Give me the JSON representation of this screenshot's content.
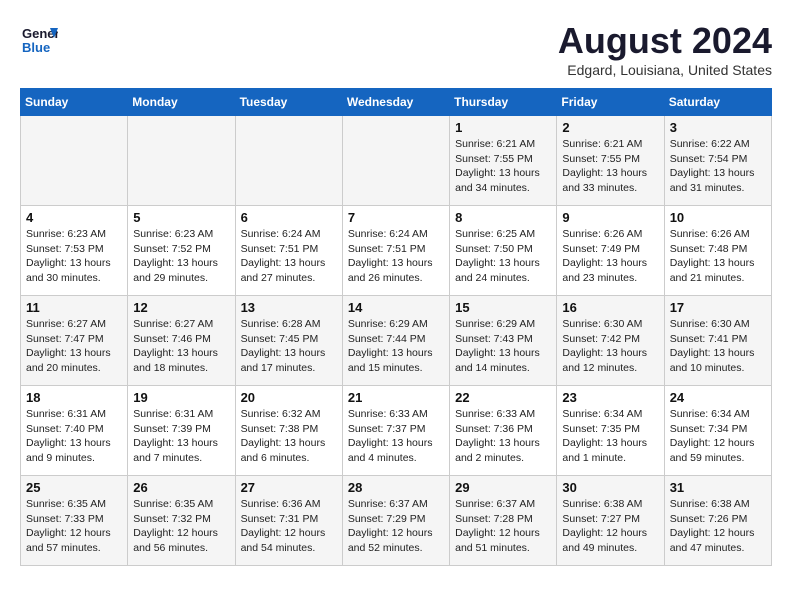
{
  "logo": {
    "line1": "General",
    "line2": "Blue"
  },
  "title": "August 2024",
  "subtitle": "Edgard, Louisiana, United States",
  "days_of_week": [
    "Sunday",
    "Monday",
    "Tuesday",
    "Wednesday",
    "Thursday",
    "Friday",
    "Saturday"
  ],
  "weeks": [
    [
      {
        "day": "",
        "info": ""
      },
      {
        "day": "",
        "info": ""
      },
      {
        "day": "",
        "info": ""
      },
      {
        "day": "",
        "info": ""
      },
      {
        "day": "1",
        "info": "Sunrise: 6:21 AM\nSunset: 7:55 PM\nDaylight: 13 hours\nand 34 minutes."
      },
      {
        "day": "2",
        "info": "Sunrise: 6:21 AM\nSunset: 7:55 PM\nDaylight: 13 hours\nand 33 minutes."
      },
      {
        "day": "3",
        "info": "Sunrise: 6:22 AM\nSunset: 7:54 PM\nDaylight: 13 hours\nand 31 minutes."
      }
    ],
    [
      {
        "day": "4",
        "info": "Sunrise: 6:23 AM\nSunset: 7:53 PM\nDaylight: 13 hours\nand 30 minutes."
      },
      {
        "day": "5",
        "info": "Sunrise: 6:23 AM\nSunset: 7:52 PM\nDaylight: 13 hours\nand 29 minutes."
      },
      {
        "day": "6",
        "info": "Sunrise: 6:24 AM\nSunset: 7:51 PM\nDaylight: 13 hours\nand 27 minutes."
      },
      {
        "day": "7",
        "info": "Sunrise: 6:24 AM\nSunset: 7:51 PM\nDaylight: 13 hours\nand 26 minutes."
      },
      {
        "day": "8",
        "info": "Sunrise: 6:25 AM\nSunset: 7:50 PM\nDaylight: 13 hours\nand 24 minutes."
      },
      {
        "day": "9",
        "info": "Sunrise: 6:26 AM\nSunset: 7:49 PM\nDaylight: 13 hours\nand 23 minutes."
      },
      {
        "day": "10",
        "info": "Sunrise: 6:26 AM\nSunset: 7:48 PM\nDaylight: 13 hours\nand 21 minutes."
      }
    ],
    [
      {
        "day": "11",
        "info": "Sunrise: 6:27 AM\nSunset: 7:47 PM\nDaylight: 13 hours\nand 20 minutes."
      },
      {
        "day": "12",
        "info": "Sunrise: 6:27 AM\nSunset: 7:46 PM\nDaylight: 13 hours\nand 18 minutes."
      },
      {
        "day": "13",
        "info": "Sunrise: 6:28 AM\nSunset: 7:45 PM\nDaylight: 13 hours\nand 17 minutes."
      },
      {
        "day": "14",
        "info": "Sunrise: 6:29 AM\nSunset: 7:44 PM\nDaylight: 13 hours\nand 15 minutes."
      },
      {
        "day": "15",
        "info": "Sunrise: 6:29 AM\nSunset: 7:43 PM\nDaylight: 13 hours\nand 14 minutes."
      },
      {
        "day": "16",
        "info": "Sunrise: 6:30 AM\nSunset: 7:42 PM\nDaylight: 13 hours\nand 12 minutes."
      },
      {
        "day": "17",
        "info": "Sunrise: 6:30 AM\nSunset: 7:41 PM\nDaylight: 13 hours\nand 10 minutes."
      }
    ],
    [
      {
        "day": "18",
        "info": "Sunrise: 6:31 AM\nSunset: 7:40 PM\nDaylight: 13 hours\nand 9 minutes."
      },
      {
        "day": "19",
        "info": "Sunrise: 6:31 AM\nSunset: 7:39 PM\nDaylight: 13 hours\nand 7 minutes."
      },
      {
        "day": "20",
        "info": "Sunrise: 6:32 AM\nSunset: 7:38 PM\nDaylight: 13 hours\nand 6 minutes."
      },
      {
        "day": "21",
        "info": "Sunrise: 6:33 AM\nSunset: 7:37 PM\nDaylight: 13 hours\nand 4 minutes."
      },
      {
        "day": "22",
        "info": "Sunrise: 6:33 AM\nSunset: 7:36 PM\nDaylight: 13 hours\nand 2 minutes."
      },
      {
        "day": "23",
        "info": "Sunrise: 6:34 AM\nSunset: 7:35 PM\nDaylight: 13 hours\nand 1 minute."
      },
      {
        "day": "24",
        "info": "Sunrise: 6:34 AM\nSunset: 7:34 PM\nDaylight: 12 hours\nand 59 minutes."
      }
    ],
    [
      {
        "day": "25",
        "info": "Sunrise: 6:35 AM\nSunset: 7:33 PM\nDaylight: 12 hours\nand 57 minutes."
      },
      {
        "day": "26",
        "info": "Sunrise: 6:35 AM\nSunset: 7:32 PM\nDaylight: 12 hours\nand 56 minutes."
      },
      {
        "day": "27",
        "info": "Sunrise: 6:36 AM\nSunset: 7:31 PM\nDaylight: 12 hours\nand 54 minutes."
      },
      {
        "day": "28",
        "info": "Sunrise: 6:37 AM\nSunset: 7:29 PM\nDaylight: 12 hours\nand 52 minutes."
      },
      {
        "day": "29",
        "info": "Sunrise: 6:37 AM\nSunset: 7:28 PM\nDaylight: 12 hours\nand 51 minutes."
      },
      {
        "day": "30",
        "info": "Sunrise: 6:38 AM\nSunset: 7:27 PM\nDaylight: 12 hours\nand 49 minutes."
      },
      {
        "day": "31",
        "info": "Sunrise: 6:38 AM\nSunset: 7:26 PM\nDaylight: 12 hours\nand 47 minutes."
      }
    ]
  ]
}
